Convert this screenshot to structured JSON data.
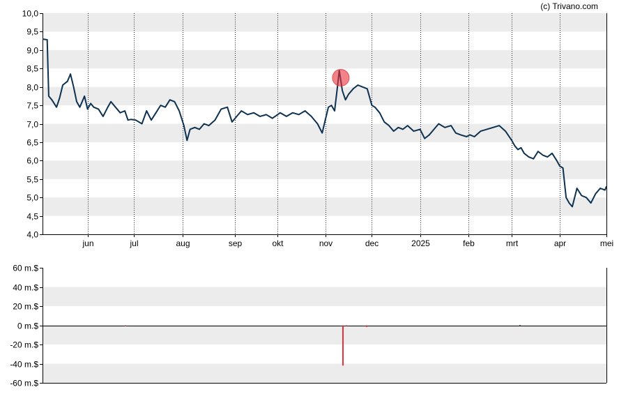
{
  "credit": "(c) Trivano.com",
  "chart_data": [
    {
      "type": "line",
      "title": "",
      "xlabel": "",
      "ylabel": "",
      "x_range": [
        "2024-05-03",
        "2025-05-01"
      ],
      "ylim": [
        4.0,
        10.0
      ],
      "y_ticks": [
        4.0,
        4.5,
        5.0,
        5.5,
        6.0,
        6.5,
        7.0,
        7.5,
        8.0,
        8.5,
        9.0,
        9.5,
        10.0
      ],
      "y_tick_labels": [
        "4,0",
        "4,5",
        "5,0",
        "5,5",
        "6,0",
        "6,5",
        "7,0",
        "7,5",
        "8,0",
        "8,5",
        "9,0",
        "9,5",
        "10,0"
      ],
      "x_ticks": [
        {
          "label": "jun",
          "date": "2024-06-01"
        },
        {
          "label": "jul",
          "date": "2024-07-01"
        },
        {
          "label": "aug",
          "date": "2024-08-01"
        },
        {
          "label": "sep",
          "date": "2024-09-04"
        },
        {
          "label": "okt",
          "date": "2024-10-01"
        },
        {
          "label": "nov",
          "date": "2024-11-01"
        },
        {
          "label": "dec",
          "date": "2024-12-01"
        },
        {
          "label": "2025",
          "date": "2025-01-01"
        },
        {
          "label": "feb",
          "date": "2025-02-01"
        },
        {
          "label": "mrt",
          "date": "2025-03-01"
        },
        {
          "label": "apr",
          "date": "2025-04-01"
        },
        {
          "label": "mei",
          "date": "2025-05-01"
        }
      ],
      "grid": "alternating horizontal bands, dotted vertical lines at month ticks",
      "line_color": "#0d3150",
      "marker": {
        "date": "2024-11-11",
        "value": 8.25,
        "color": "#e8303a"
      },
      "series": [
        {
          "x": [
            "2024-05-03",
            "2024-05-06",
            "2024-05-07",
            "2024-05-09",
            "2024-05-12",
            "2024-05-14",
            "2024-05-16",
            "2024-05-19",
            "2024-05-21",
            "2024-05-23",
            "2024-05-25",
            "2024-05-27",
            "2024-05-30",
            "2024-06-01",
            "2024-06-03",
            "2024-06-05",
            "2024-06-08",
            "2024-06-11",
            "2024-06-14",
            "2024-06-16",
            "2024-06-19",
            "2024-06-22",
            "2024-06-25",
            "2024-06-27",
            "2024-06-29",
            "2024-07-02",
            "2024-07-06",
            "2024-07-09",
            "2024-07-12",
            "2024-07-15",
            "2024-07-18",
            "2024-07-21",
            "2024-07-24",
            "2024-07-27",
            "2024-07-30",
            "2024-08-02",
            "2024-08-04",
            "2024-08-06",
            "2024-08-09",
            "2024-08-12",
            "2024-08-15",
            "2024-08-18",
            "2024-08-22",
            "2024-08-26",
            "2024-08-30",
            "2024-09-02",
            "2024-09-05",
            "2024-09-08",
            "2024-09-12",
            "2024-09-16",
            "2024-09-20",
            "2024-09-24",
            "2024-09-28",
            "2024-10-03",
            "2024-10-07",
            "2024-10-11",
            "2024-10-15",
            "2024-10-19",
            "2024-10-23",
            "2024-10-27",
            "2024-10-30",
            "2024-11-01",
            "2024-11-03",
            "2024-11-05",
            "2024-11-07",
            "2024-11-09",
            "2024-11-10",
            "2024-11-12",
            "2024-11-14",
            "2024-11-16",
            "2024-11-19",
            "2024-11-22",
            "2024-11-25",
            "2024-11-28",
            "2024-12-01",
            "2024-12-03",
            "2024-12-06",
            "2024-12-09",
            "2024-12-12",
            "2024-12-15",
            "2024-12-18",
            "2024-12-21",
            "2024-12-24",
            "2024-12-28",
            "2025-01-01",
            "2025-01-04",
            "2025-01-07",
            "2025-01-10",
            "2025-01-13",
            "2025-01-17",
            "2025-01-21",
            "2025-01-24",
            "2025-01-27",
            "2025-01-31",
            "2025-02-02",
            "2025-02-05",
            "2025-02-09",
            "2025-02-13",
            "2025-02-17",
            "2025-02-21",
            "2025-02-25",
            "2025-03-01",
            "2025-03-03",
            "2025-03-05",
            "2025-03-07",
            "2025-03-09",
            "2025-03-12",
            "2025-03-15",
            "2025-03-18",
            "2025-03-21",
            "2025-03-24",
            "2025-03-27",
            "2025-03-30",
            "2025-04-01",
            "2025-04-03",
            "2025-04-05",
            "2025-04-07",
            "2025-04-09",
            "2025-04-12",
            "2025-04-15",
            "2025-04-18",
            "2025-04-21",
            "2025-04-24",
            "2025-04-27",
            "2025-04-30",
            "2025-05-01"
          ],
          "y": [
            9.3,
            9.28,
            7.75,
            7.65,
            7.45,
            7.7,
            8.05,
            8.15,
            8.35,
            8.0,
            7.6,
            7.45,
            7.75,
            7.4,
            7.55,
            7.45,
            7.4,
            7.2,
            7.45,
            7.6,
            7.45,
            7.3,
            7.35,
            7.1,
            7.12,
            7.1,
            7.0,
            7.35,
            7.1,
            7.3,
            7.5,
            7.45,
            7.65,
            7.6,
            7.35,
            6.95,
            6.55,
            6.85,
            6.9,
            6.85,
            7.0,
            6.95,
            7.1,
            7.4,
            7.45,
            7.05,
            7.2,
            7.35,
            7.25,
            7.3,
            7.2,
            7.25,
            7.15,
            7.3,
            7.2,
            7.3,
            7.25,
            7.35,
            7.2,
            7.0,
            6.75,
            7.1,
            7.45,
            7.5,
            7.35,
            8.05,
            8.45,
            7.9,
            7.65,
            7.8,
            7.95,
            8.05,
            8.0,
            7.95,
            7.5,
            7.45,
            7.3,
            7.05,
            6.95,
            6.8,
            6.9,
            6.85,
            6.95,
            6.8,
            6.85,
            6.6,
            6.7,
            6.85,
            7.0,
            6.9,
            6.95,
            6.75,
            6.7,
            6.65,
            6.7,
            6.65,
            6.8,
            6.85,
            6.9,
            6.95,
            6.8,
            6.55,
            6.4,
            6.3,
            6.35,
            6.2,
            6.1,
            6.05,
            6.25,
            6.15,
            6.1,
            6.2,
            6.0,
            5.85,
            5.8,
            5.0,
            4.85,
            4.75,
            5.25,
            5.05,
            5.0,
            4.85,
            5.1,
            5.25,
            5.2,
            5.3
          ]
        }
      ]
    },
    {
      "type": "bar",
      "title": "",
      "xlabel": "",
      "ylabel": "",
      "ylim": [
        -60,
        60
      ],
      "y_ticks": [
        -60,
        -40,
        -20,
        0,
        20,
        40,
        60
      ],
      "y_tick_labels": [
        "-60 m.$",
        "-40 m.$",
        "-20 m.$",
        "0 m.$",
        "20 m.$",
        "40 m.$",
        "60 m.$"
      ],
      "grid": "alternating horizontal bands",
      "series": [
        {
          "x": [
            "2024-06-25",
            "2024-11-12",
            "2024-11-14",
            "2024-11-27",
            "2025-03-06"
          ],
          "values": [
            -0.8,
            -42,
            -0.6,
            -1.8,
            0.4
          ],
          "colors": [
            "#e8303a",
            "#e8303a",
            "#e8303a",
            "#e8303a",
            "#2e8b2e"
          ]
        }
      ]
    }
  ]
}
